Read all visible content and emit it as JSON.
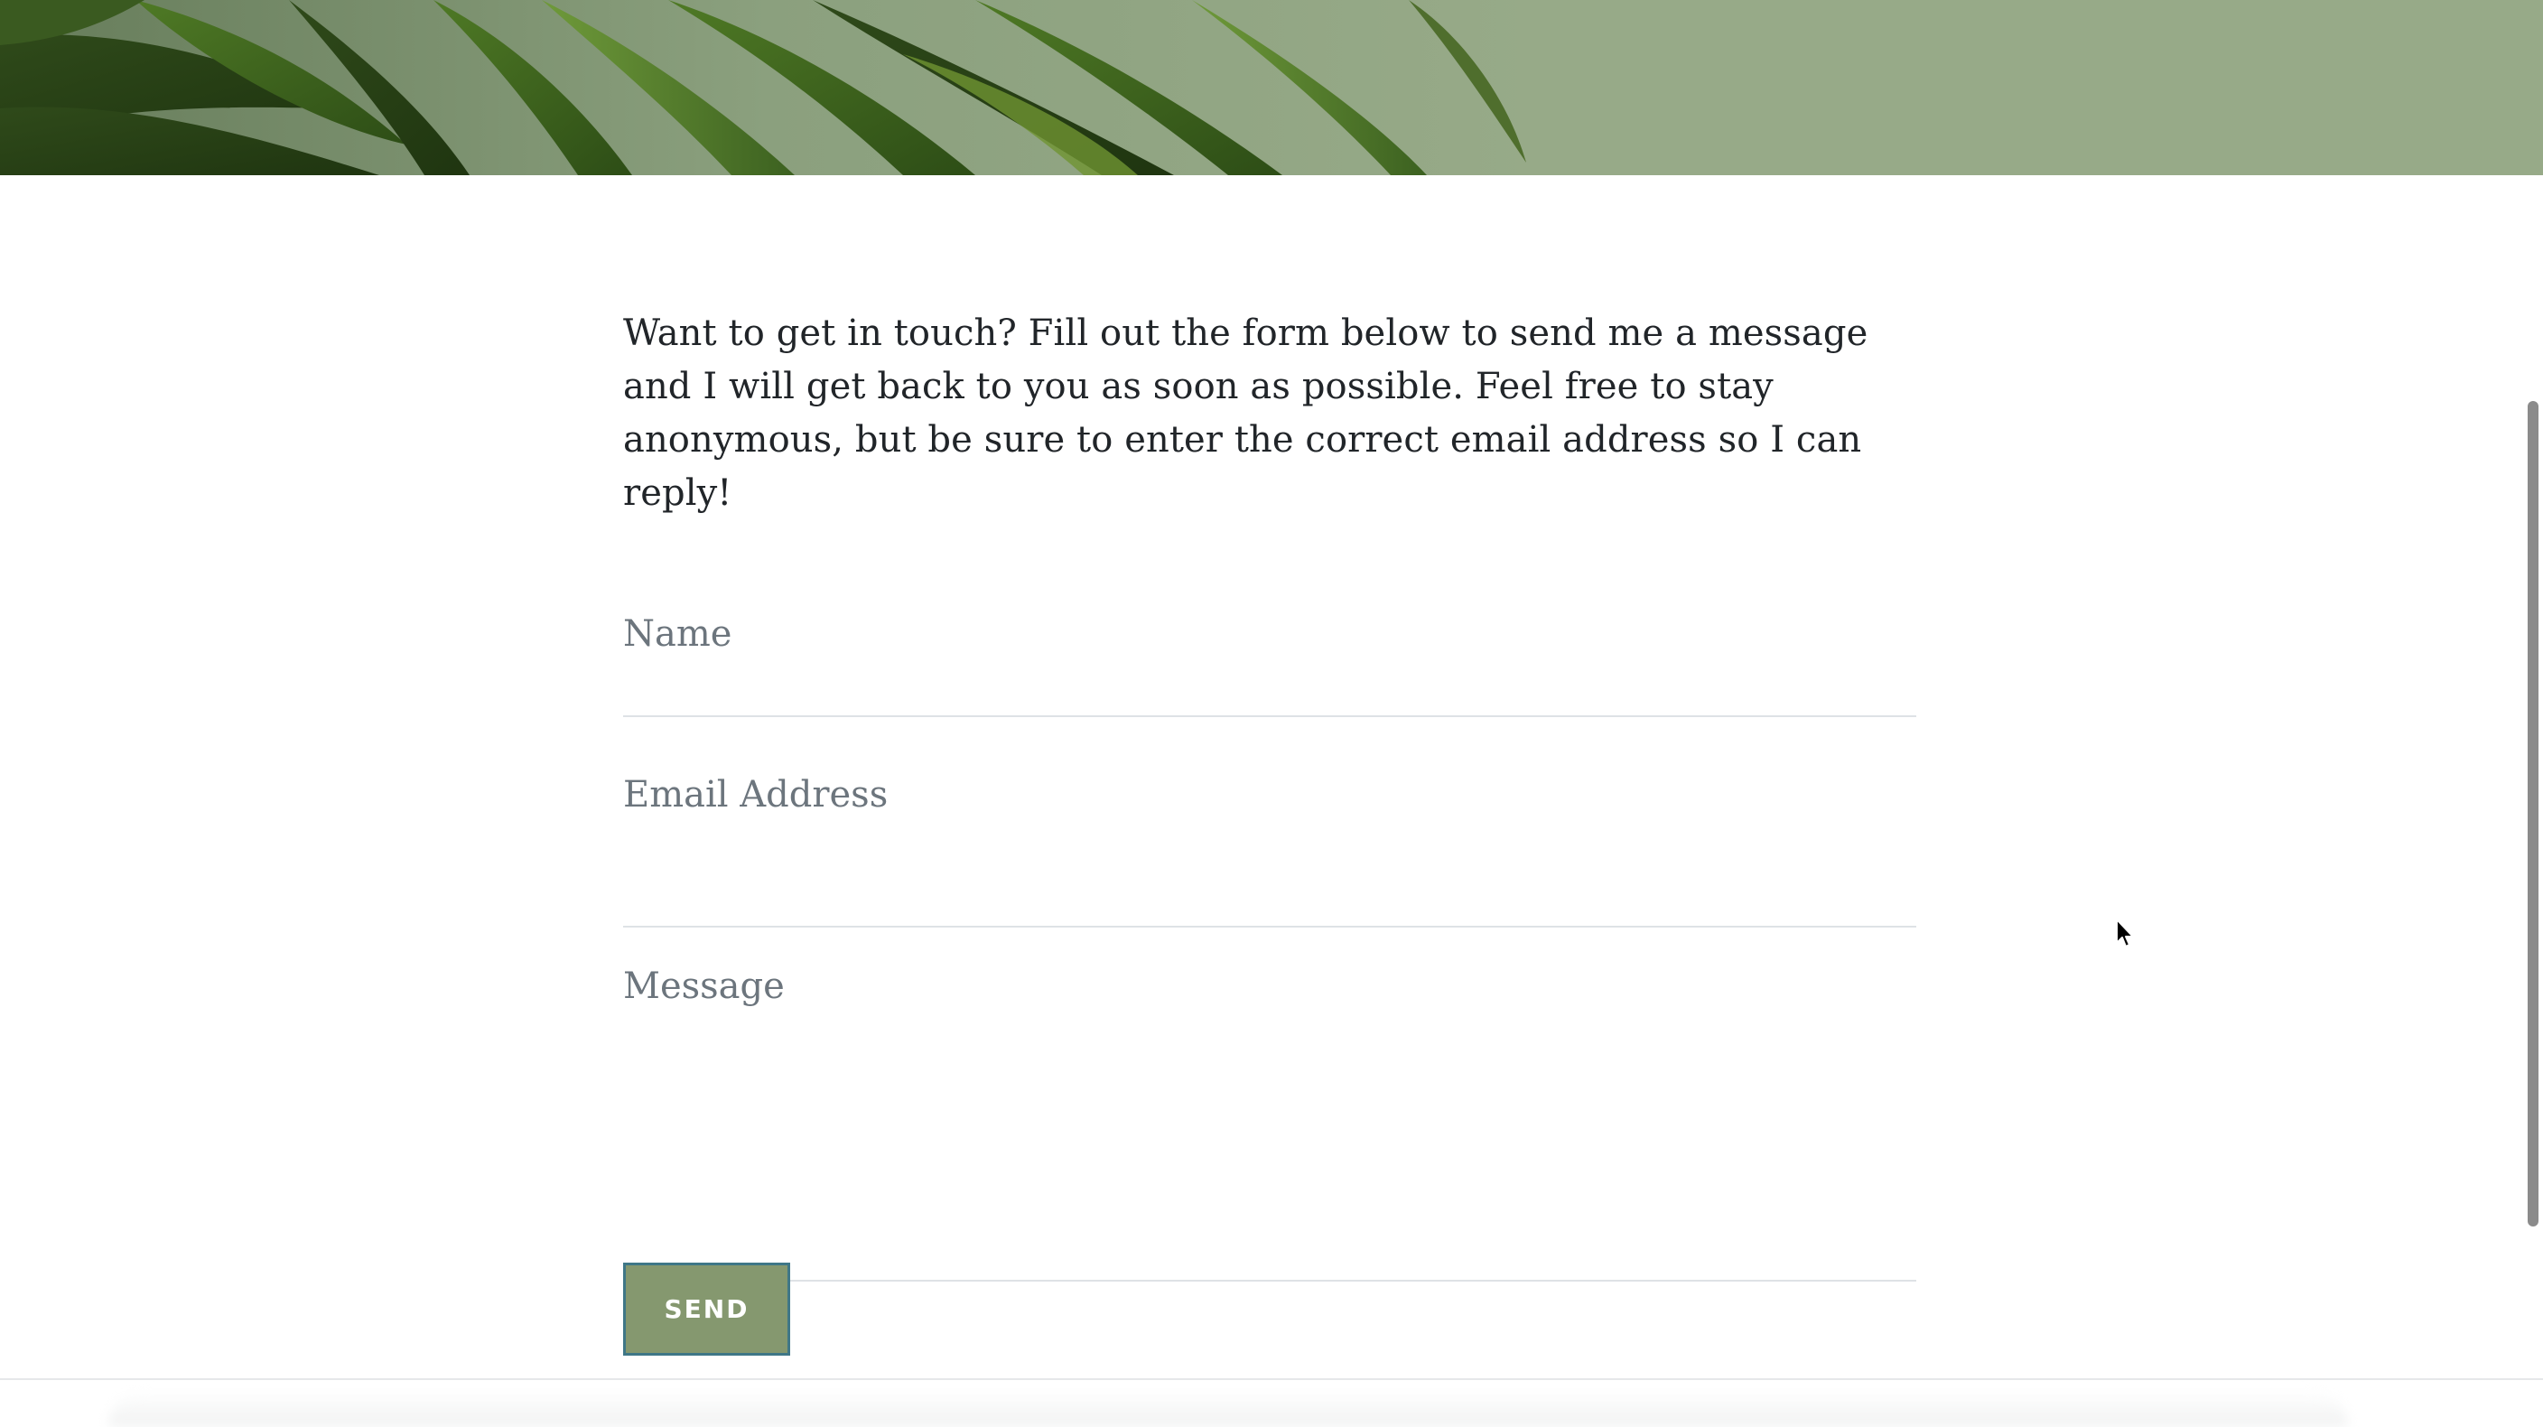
{
  "hero": {
    "background_color": "#97aa88",
    "image": "plant-leaves"
  },
  "intro": {
    "text": "Want to get in touch? Fill out the form below to send me a message and I will get back to you as soon as possible. Feel free to stay anonymous, but be sure to enter the correct email address so I can reply!"
  },
  "form": {
    "name_placeholder": "Name",
    "name_value": "",
    "email_placeholder": "Email Address",
    "email_value": "",
    "message_placeholder": "Message",
    "message_value": "",
    "send_label": "SEND",
    "send_color": "#85986f",
    "send_border_color": "#3f7787"
  },
  "icons": {
    "cursor": "mouse-pointer-icon"
  }
}
